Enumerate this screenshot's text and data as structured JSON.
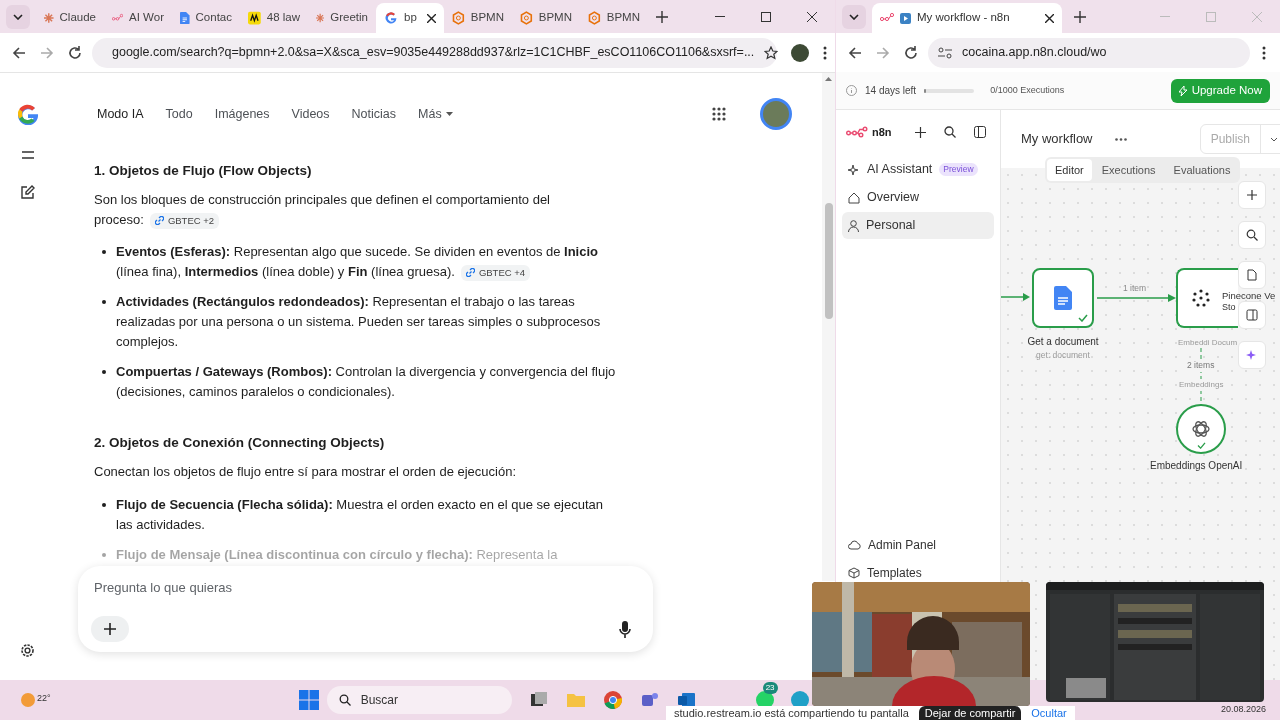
{
  "left_browser": {
    "tabs": [
      {
        "label": "Claude",
        "kind": "asterisk",
        "selected": false
      },
      {
        "label": "AI Wor",
        "kind": "flow",
        "selected": false
      },
      {
        "label": "Contac",
        "kind": "doc",
        "selected": false
      },
      {
        "label": "48 law",
        "kind": "book",
        "selected": false
      },
      {
        "label": "Greetin",
        "kind": "asterisk",
        "selected": false
      },
      {
        "label": "bp",
        "kind": "google",
        "selected": true
      },
      {
        "label": "BPMN",
        "kind": "hex",
        "selected": false
      },
      {
        "label": "BPMN",
        "kind": "hex",
        "selected": false
      },
      {
        "label": "BPMN",
        "kind": "hex",
        "selected": false
      }
    ],
    "url": "google.com/search?q=bpmn+2.0&sa=X&sca_esv=9035e449288dd937&rlz=1C1CHBF_esCO1106CO1106&sxsrf=...",
    "nav": [
      {
        "label": "Modo IA",
        "selected": true
      },
      {
        "label": "Todo",
        "selected": false
      },
      {
        "label": "Imágenes",
        "selected": false
      },
      {
        "label": "Videos",
        "selected": false
      },
      {
        "label": "Noticias",
        "selected": false
      },
      {
        "label": "Más",
        "selected": false
      }
    ],
    "sections": [
      {
        "heading": "1. Objetos de Flujo (Flow Objects)",
        "intro": "Son los bloques de construcción principales que definen el comportamiento del proceso:",
        "chip": "GBTEC +2",
        "bullets": [
          {
            "text": "**Eventos (Esferas):** Representan algo que sucede. Se dividen en eventos de **Inicio** (línea fina), **Intermedios** (línea doble) y **Fin** (línea gruesa).",
            "chip": "GBTEC +4",
            "faded": false
          },
          {
            "text": "**Actividades (Rectángulos redondeados):** Representan el trabajo o las tareas realizadas por una persona o un sistema. Pueden ser tareas simples o subprocesos complejos.",
            "faded": false
          },
          {
            "text": "**Compuertas / Gateways (Rombos):** Controlan la divergencia y convergencia del flujo (decisiones, caminos paralelos o condicionales).",
            "faded": false
          }
        ]
      },
      {
        "heading": "2. Objetos de Conexión (Connecting Objects)",
        "intro": "Conectan los objetos de flujo entre sí para mostrar el orden de ejecución:",
        "bullets": [
          {
            "text": "**Flujo de Secuencia (Flecha sólida):** Muestra el orden exacto en el que se ejecutan las actividades.",
            "faded": false
          },
          {
            "text": "**Flujo de Mensaje (Línea discontinua con círculo y flecha):** Representa la",
            "faded": true
          }
        ]
      }
    ],
    "chat": {
      "placeholder": "Pregunta lo que quieras"
    }
  },
  "right_browser": {
    "tab": "My workflow - n8n",
    "url": "cocaina.app.n8n.cloud/wo",
    "trial": {
      "text": "14 days left",
      "level": 0.04,
      "executions": "0/1000 Executions",
      "button": "Upgrade Now"
    },
    "brand": "n8n",
    "sidebar": [
      {
        "label": "AI Assistant",
        "kind": "sparkle",
        "badge": "Preview",
        "selected": false
      },
      {
        "label": "Overview",
        "kind": "home",
        "selected": false
      },
      {
        "label": "Personal",
        "kind": "user",
        "selected": true
      }
    ],
    "sidebar_bottom": [
      {
        "label": "Admin Panel",
        "kind": "cloud"
      },
      {
        "label": "Templates",
        "kind": "box"
      }
    ],
    "workflow": {
      "title": "My workflow",
      "publish": "Publish",
      "tabs": [
        {
          "label": "Editor",
          "selected": true
        },
        {
          "label": "Executions",
          "selected": false
        },
        {
          "label": "Evaluations",
          "selected": false
        }
      ]
    },
    "nodes": [
      {
        "kind": "gdoc",
        "title": "Get a document",
        "subtitle": "get: document"
      },
      {
        "kind": "pinecone",
        "title": "Pinecone Ve",
        "title_2": "Sto"
      },
      {
        "kind": "openai",
        "title": "Embeddings OpenAI"
      }
    ],
    "edges": {
      "main": "1 item",
      "ports": "Embeddi Docum",
      "sub": "2 items",
      "sub_label": "Embeddings"
    }
  },
  "taskbar": {
    "weather": "22°",
    "search": "Buscar",
    "badge": "23",
    "date": "20.08.2026"
  },
  "share_bar": {
    "text": "studio.restream.io está compartiendo tu pantalla",
    "stop": "Dejar de compartir",
    "hide": "Ocultar"
  }
}
